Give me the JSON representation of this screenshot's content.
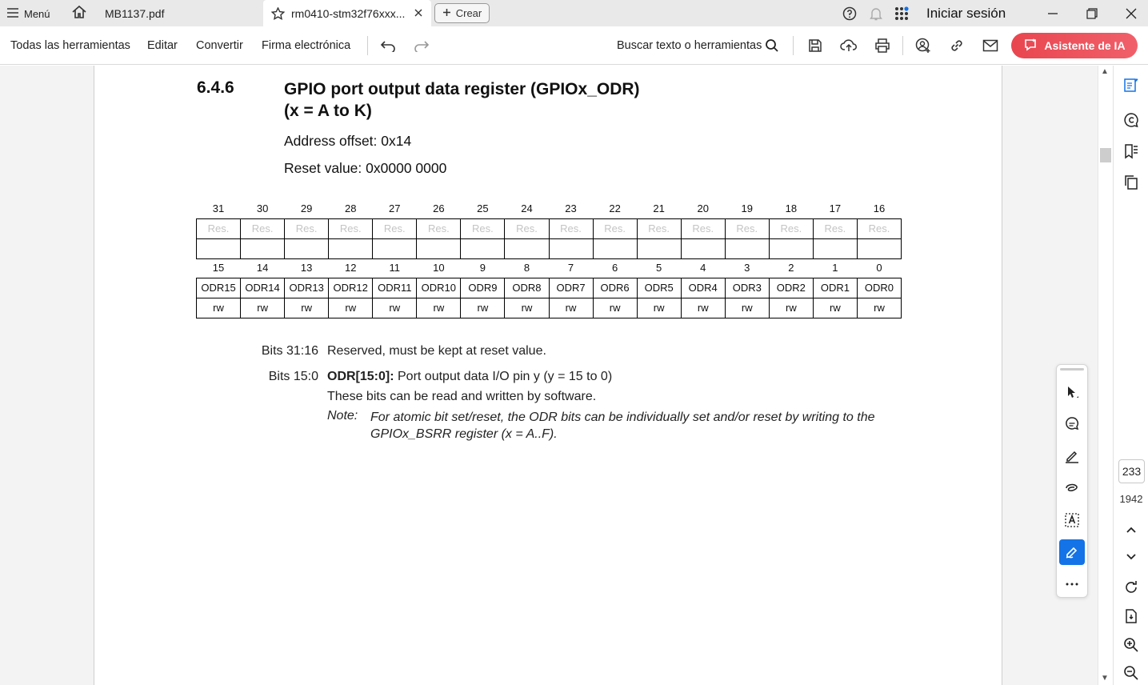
{
  "tabbar": {
    "menu_label": "Menú",
    "tabs": [
      {
        "label": "MB1137.pdf"
      },
      {
        "label": "rm0410-stm32f76xxx..."
      }
    ],
    "new_tab_label": "Crear",
    "signin_label": "Iniciar sesión"
  },
  "toolbar": {
    "items": [
      "Todas las herramientas",
      "Editar",
      "Convertir",
      "Firma electrónica"
    ],
    "search_label": "Buscar texto o herramientas",
    "ai_label": "Asistente de IA"
  },
  "document": {
    "section_number": "6.4.6",
    "section_title_line1": "GPIO port output data register (GPIOx_ODR)",
    "section_title_line2": "(x = A to K)",
    "address_offset": "Address offset: 0x14",
    "reset_value": "Reset value: 0x0000 0000",
    "upper_bits": [
      "31",
      "30",
      "29",
      "28",
      "27",
      "26",
      "25",
      "24",
      "23",
      "22",
      "21",
      "20",
      "19",
      "18",
      "17",
      "16"
    ],
    "upper_fields": [
      "Res.",
      "Res.",
      "Res.",
      "Res.",
      "Res.",
      "Res.",
      "Res.",
      "Res.",
      "Res.",
      "Res.",
      "Res.",
      "Res.",
      "Res.",
      "Res.",
      "Res.",
      "Res."
    ],
    "lower_bits": [
      "15",
      "14",
      "13",
      "12",
      "11",
      "10",
      "9",
      "8",
      "7",
      "6",
      "5",
      "4",
      "3",
      "2",
      "1",
      "0"
    ],
    "lower_fields": [
      "ODR15",
      "ODR14",
      "ODR13",
      "ODR12",
      "ODR11",
      "ODR10",
      "ODR9",
      "ODR8",
      "ODR7",
      "ODR6",
      "ODR5",
      "ODR4",
      "ODR3",
      "ODR2",
      "ODR1",
      "ODR0"
    ],
    "lower_access": [
      "rw",
      "rw",
      "rw",
      "rw",
      "rw",
      "rw",
      "rw",
      "rw",
      "rw",
      "rw",
      "rw",
      "rw",
      "rw",
      "rw",
      "rw",
      "rw"
    ],
    "bits1_label": "Bits 31:16",
    "bits1_desc": "Reserved, must be kept at reset value.",
    "bits2_label": "Bits 15:0",
    "bits2_field": "ODR[15:0]:",
    "bits2_desc": " Port output data I/O pin y (y = 15 to 0)",
    "bits2_line2": "These bits can be read and written by software.",
    "note_label": "Note:",
    "note_text": "For atomic bit set/reset, the ODR bits can be individually set and/or reset by writing to the GPIOx_BSRR register (x = A..F)."
  },
  "pagination": {
    "current_page": "233",
    "total_pages": "1942"
  }
}
